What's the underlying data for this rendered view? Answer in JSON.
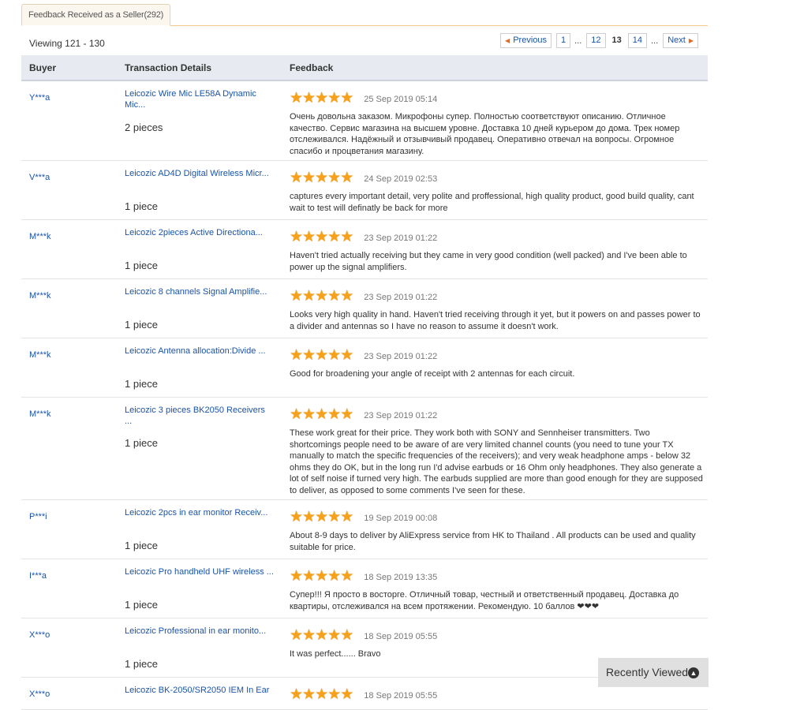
{
  "tab": {
    "label": "Feedback Received as a Seller(292)"
  },
  "viewing": "Viewing 121 - 130",
  "pagination": {
    "previous": "Previous",
    "pages": [
      "1",
      "...",
      "12",
      "13",
      "14",
      "..."
    ],
    "current": "13",
    "next": "Next"
  },
  "columns": {
    "buyer": "Buyer",
    "details": "Transaction Details",
    "feedback": "Feedback"
  },
  "rows": [
    {
      "buyer": "Y***a",
      "product": "Leicozic Wire Mic LE58A Dynamic Mic...",
      "qty": "2 pieces",
      "rating": 5,
      "date": "25 Sep 2019 05:14",
      "text": "Очень довольна заказом. Микрофоны супер. Полностью соответствуют описанию. Отличное качество. Сервис магазина на высшем уровне. Доставка 10 дней курьером до дома. Трек номер отслеживался. Надёжный и отзывчивый продавец. Оперативно отвечал на вопросы. Огромное спасибо и процветания магазину."
    },
    {
      "buyer": "V***a",
      "product": "Leicozic AD4D Digital Wireless Micr...",
      "qty": "1 piece",
      "rating": 5,
      "date": "24 Sep 2019 02:53",
      "text": "captures every important detail, very polite and proffessional, high quality product, good build quality, cant wait to test will definatly be back for more"
    },
    {
      "buyer": "M***k",
      "product": "Leicozic 2pieces Active Directiona...",
      "qty": "1 piece",
      "rating": 5,
      "date": "23 Sep 2019 01:22",
      "text": "Haven't tried actually receiving but they came in very good condition (well packed) and I've been able to power up the signal amplifiers."
    },
    {
      "buyer": "M***k",
      "product": "Leicozic 8 channels Signal Amplifie...",
      "qty": "1 piece",
      "rating": 5,
      "date": "23 Sep 2019 01:22",
      "text": "Looks very high quality in hand. Haven't tried receiving through it yet, but it powers on and passes power to a divider and antennas so I have no reason to assume it doesn't work."
    },
    {
      "buyer": "M***k",
      "product": "Leicozic Antenna allocation:Divide ...",
      "qty": "1 piece",
      "rating": 5,
      "date": "23 Sep 2019 01:22",
      "text": "Good for broadening your angle of receipt with 2 antennas for each circuit."
    },
    {
      "buyer": "M***k",
      "product": "Leicozic 3 pieces BK2050 Receivers ...",
      "qty": "1 piece",
      "rating": 5,
      "date": "23 Sep 2019 01:22",
      "text": "These work great for their price. They work both with SONY and Sennheiser transmitters. Two shortcomings people need to be aware of are very limited channel counts (you need to tune your TX manually to match the specific frequencies of the receivers); and very weak headphone amps - below 32 ohms they do OK, but in the long run I'd advise earbuds or 16 Ohm only headphones. They also generate a lot of self noise if turned very high. The earbuds supplied are more than good enough for they are supposed to deliver, as opposed to some comments I've seen for these."
    },
    {
      "buyer": "P***i",
      "product": "Leicozic 2pcs in ear monitor Receiv...",
      "qty": "1 piece",
      "rating": 5,
      "date": "19 Sep 2019 00:08",
      "text": "About 8-9 days to deliver by AliExpress service from HK to Thailand . All products can be used and quality suitable for price."
    },
    {
      "buyer": "I***a",
      "product": "Leicozic Pro handheld UHF wireless ...",
      "qty": "1 piece",
      "rating": 5,
      "date": "18 Sep 2019 13:35",
      "text": "Супер!!! Я просто в восторге. Отличный товар, честный и ответственный продавец. Доставка до квартиры, отслеживался на всем протяжении. Рекомендую. 10 баллов ❤❤❤"
    },
    {
      "buyer": "X***o",
      "product": "Leicozic Professional in ear monito...",
      "qty": "1 piece",
      "rating": 5,
      "date": "18 Sep 2019 05:55",
      "text": "It was perfect...... Bravo"
    },
    {
      "buyer": "X***o",
      "product": "Leicozic BK-2050/SR2050 IEM In Ear",
      "qty": "",
      "rating": 5,
      "date": "18 Sep 2019 05:55",
      "text": ""
    }
  ],
  "recently_viewed": {
    "label": "Recently Viewed",
    "icon": "chevron-up-circle-icon"
  },
  "colors": {
    "link": "#1a53a8",
    "star": "#f5a11c",
    "tab_border": "#f0c98a",
    "header_bg": "#e7eaf1"
  }
}
